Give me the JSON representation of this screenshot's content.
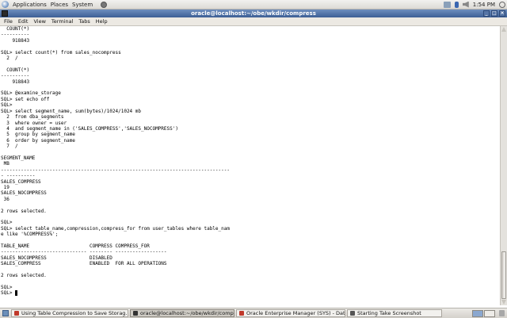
{
  "top_panel": {
    "menus": [
      "Applications",
      "Places",
      "System"
    ],
    "clock": "1:54 PM"
  },
  "window": {
    "title": "oracle@localhost:~/obe/wkdir/compress",
    "menu": [
      "File",
      "Edit",
      "View",
      "Terminal",
      "Tabs",
      "Help"
    ]
  },
  "terminal": {
    "lines": [
      "  COUNT(*)",
      "----------",
      "    918843",
      "",
      "SQL> select count(*) from sales_nocompress",
      "  2  /",
      "",
      "  COUNT(*)",
      "----------",
      "    918843",
      "",
      "SQL> @examine_storage",
      "SQL> set echo off",
      "SQL>",
      "SQL> select segment_name, sum(bytes)/1024/1024 mb",
      "  2  from dba_segments",
      "  3  where owner = user",
      "  4  and segment_name in ('SALES_COMPRESS','SALES_NOCOMPRESS')",
      "  5  group by segment_name",
      "  6  order by segment_name",
      "  7  /",
      "",
      "SEGMENT_NAME",
      " MB",
      "--------------------------------------------------------------------------------",
      "- ----------",
      "SALES_COMPRESS",
      " 19",
      "SALES_NOCOMPRESS",
      " 36",
      "",
      "2 rows selected.",
      "",
      "SQL>",
      "SQL> select table_name,compression,compress_for from user_tables where table_nam",
      "e like '%COMPRESS%';",
      "",
      "TABLE_NAME                     COMPRESS COMPRESS_FOR",
      "------------------------------ -------- ------------------",
      "SALES_NOCOMPRESS               DISABLED",
      "SALES_COMPRESS                 ENABLED  FOR ALL OPERATIONS",
      "",
      "2 rows selected.",
      "",
      "SQL>",
      "SQL> "
    ]
  },
  "taskbar": {
    "tasks": [
      {
        "label": "Using Table Compression to Save Storag...",
        "icon_color": "#c0392b",
        "active": false
      },
      {
        "label": "oracle@localhost:~/obe/wkdir/compress",
        "icon_color": "#333333",
        "active": true
      },
      {
        "label": "Oracle Enterprise Manager (SYS) - Datab...",
        "icon_color": "#c0392b",
        "active": false
      },
      {
        "label": "Starting Take Screenshot",
        "icon_color": "#555555",
        "active": false
      }
    ]
  }
}
